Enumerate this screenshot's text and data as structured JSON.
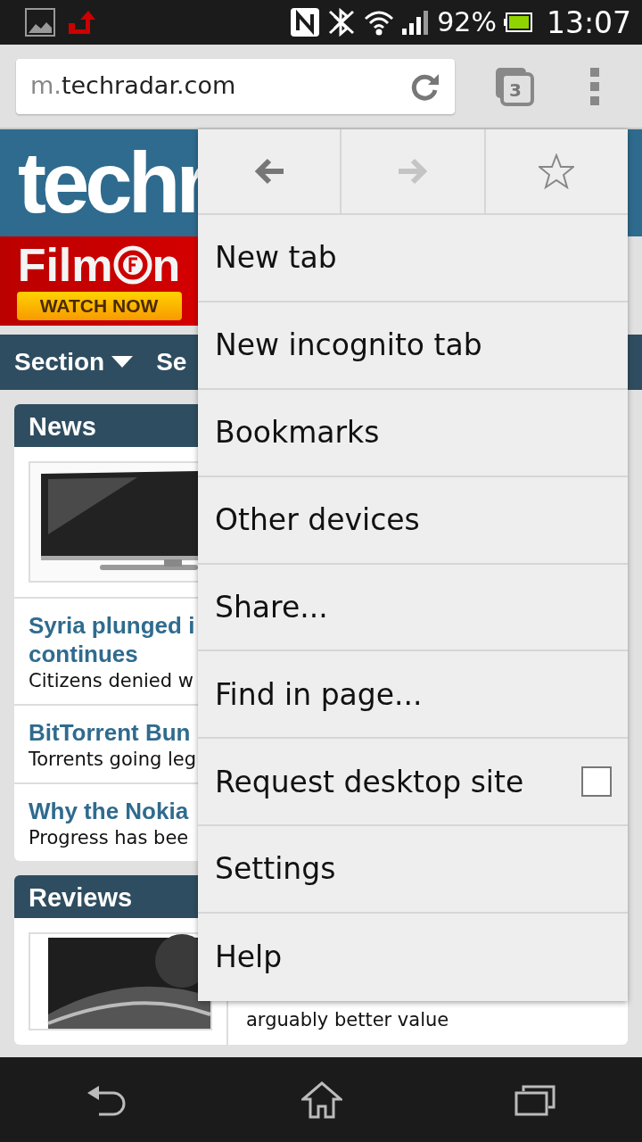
{
  "status_bar": {
    "battery": "92%",
    "time": "13:07"
  },
  "toolbar": {
    "url": {
      "prefix": "m.",
      "host": "techradar.com"
    },
    "tab_count": "3"
  },
  "site": {
    "logo": "techr",
    "ad": {
      "brand_start": "Film",
      "brand_end": "n",
      "button": "WATCH NOW"
    },
    "nav": [
      "Section",
      "Se"
    ],
    "news": {
      "title": "News",
      "articles": [
        {
          "title": "Syria plunged i",
          "title_2": "continues",
          "summary": "Citizens denied w"
        },
        {
          "title": "BitTorrent Bun",
          "summary": "Torrents going leg"
        },
        {
          "title": "Why the Nokia",
          "summary": "Progress has bee"
        }
      ]
    },
    "reviews": {
      "title": "Reviews",
      "summary": "arguably better value"
    }
  },
  "menu": {
    "nav_buttons": [
      {
        "kind": "back",
        "disabled": false
      },
      {
        "kind": "forward",
        "disabled": true
      },
      {
        "kind": "star",
        "disabled": false
      }
    ],
    "items": [
      {
        "label": "New tab",
        "kind": "plain"
      },
      {
        "label": "New incognito tab",
        "kind": "plain"
      },
      {
        "label": "Bookmarks",
        "kind": "plain"
      },
      {
        "label": "Other devices",
        "kind": "plain"
      },
      {
        "label": "Share...",
        "kind": "plain"
      },
      {
        "label": "Find in page...",
        "kind": "plain"
      },
      {
        "label": "Request desktop site",
        "kind": "checkbox",
        "checked": false
      },
      {
        "label": "Settings",
        "kind": "plain"
      },
      {
        "label": "Help",
        "kind": "plain"
      }
    ]
  }
}
